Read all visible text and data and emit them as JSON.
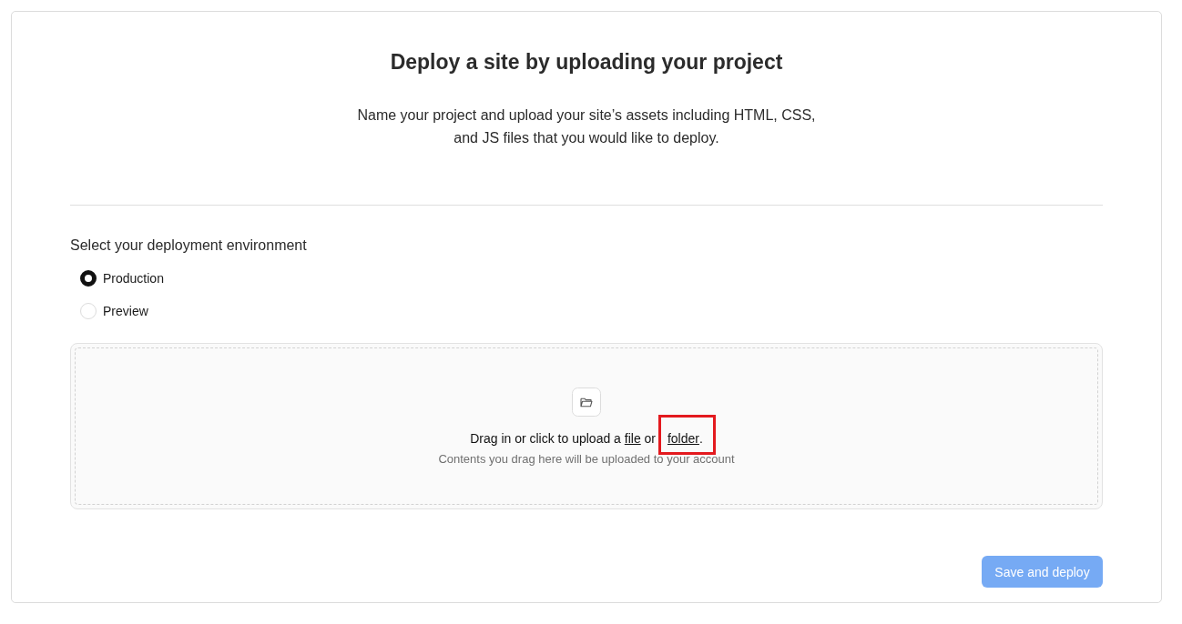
{
  "title": "Deploy a site by uploading your project",
  "description": "Name your project and upload your site’s assets including HTML, CSS, and JS files that you would like to deploy.",
  "environment": {
    "label": "Select your deployment environment",
    "options": [
      {
        "label": "Production",
        "selected": true
      },
      {
        "label": "Preview",
        "selected": false
      }
    ]
  },
  "upload": {
    "prompt": [
      {
        "kind": "text",
        "text": "Drag in or click to upload a "
      },
      {
        "kind": "link",
        "text": "file",
        "highlighted": false
      },
      {
        "kind": "text",
        "text": " or "
      },
      {
        "kind": "link",
        "text": "folder",
        "highlighted": true
      },
      {
        "kind": "text",
        "text": "."
      }
    ],
    "hint": "Contents you drag here will be uploaded to your account"
  },
  "submit": {
    "label": "Save and deploy",
    "disabled": true
  }
}
